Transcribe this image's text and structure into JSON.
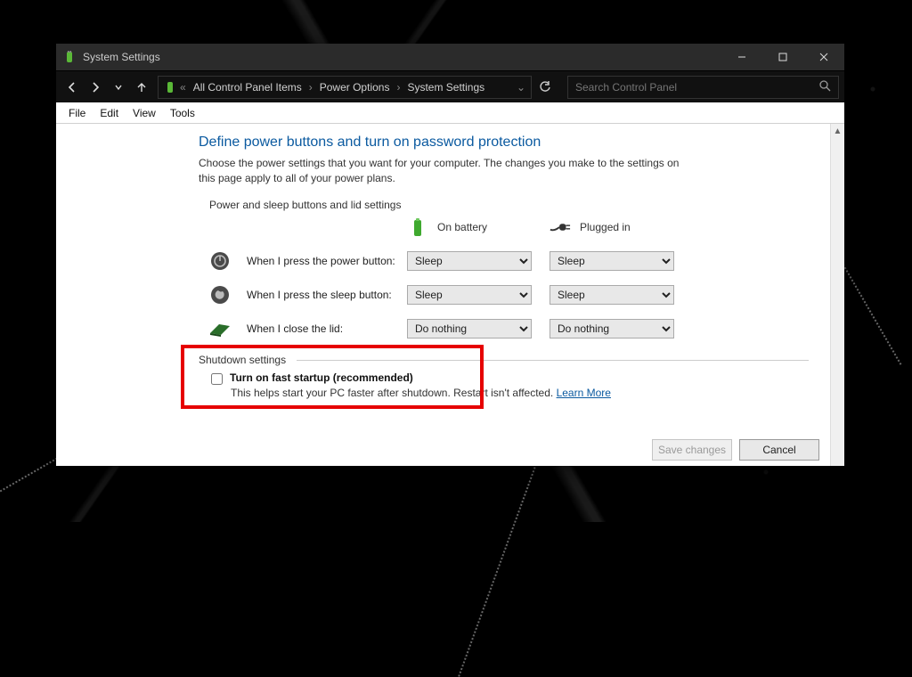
{
  "titlebar": {
    "app_name": "System Settings"
  },
  "breadcrumb": {
    "items": [
      "All Control Panel Items",
      "Power Options",
      "System Settings"
    ]
  },
  "search": {
    "placeholder": "Search Control Panel"
  },
  "menubar": {
    "items": [
      "File",
      "Edit",
      "View",
      "Tools"
    ]
  },
  "page": {
    "heading": "Define power buttons and turn on password protection",
    "description": "Choose the power settings that you want for your computer. The changes you make to the settings on this page apply to all of your power plans.",
    "group_label": "Power and sleep buttons and lid settings",
    "columns": {
      "battery": "On battery",
      "plugged": "Plugged in"
    },
    "rows": [
      {
        "label": "When I press the power button:",
        "battery": "Sleep",
        "plugged": "Sleep"
      },
      {
        "label": "When I press the sleep button:",
        "battery": "Sleep",
        "plugged": "Sleep"
      },
      {
        "label": "When I close the lid:",
        "battery": "Do nothing",
        "plugged": "Do nothing"
      }
    ]
  },
  "shutdown": {
    "section_label": "Shutdown settings",
    "fast_startup_label": "Turn on fast startup (recommended)",
    "fast_startup_checked": false,
    "help_text": "This helps start your PC faster after shutdown. Restart isn't affected.",
    "learn_more": "Learn More"
  },
  "footer": {
    "save": "Save changes",
    "cancel": "Cancel"
  }
}
